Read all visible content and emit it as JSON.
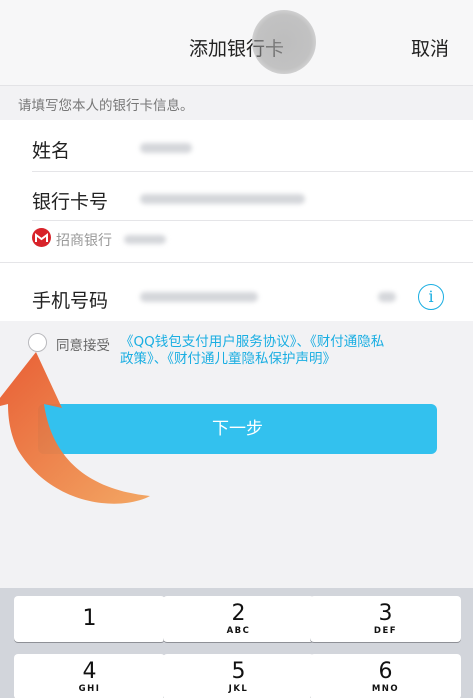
{
  "nav": {
    "title": "添加银行卡",
    "cancel": "取消"
  },
  "hint": "请填写您本人的银行卡信息。",
  "form": {
    "name_label": "姓名",
    "card_label": "银行卡号",
    "bank_name": "招商银行",
    "phone_label": "手机号码",
    "info_glyph": "i"
  },
  "agreement": {
    "label": "同意接受",
    "links_text": "《QQ钱包支付用户服务协议》、《财付通隐私政策》、《财付通儿童隐私保护声明》"
  },
  "next_button": "下一步",
  "keyboard": {
    "keys": [
      {
        "num": "1",
        "letters": ""
      },
      {
        "num": "2",
        "letters": "ABC"
      },
      {
        "num": "3",
        "letters": "DEF"
      },
      {
        "num": "4",
        "letters": "GHI"
      },
      {
        "num": "5",
        "letters": "JKL"
      },
      {
        "num": "6",
        "letters": "MNO"
      }
    ]
  },
  "colors": {
    "accent": "#1aaee2",
    "button": "#33c1ee",
    "bank_logo": "#d8232a",
    "arrow": "#e96a2a"
  }
}
